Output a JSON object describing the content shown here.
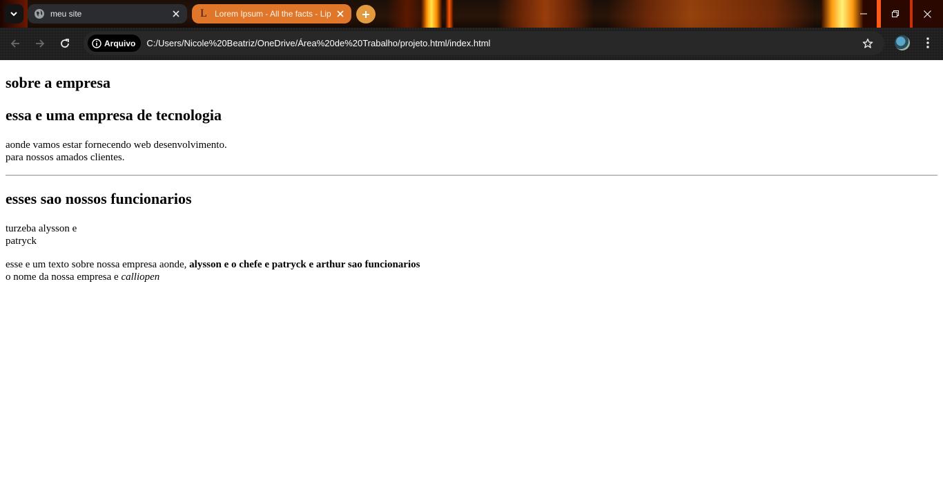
{
  "browser": {
    "tabs": [
      {
        "title": "meu site",
        "active": true
      },
      {
        "title": "Lorem Ipsum - All the facts - Lip",
        "active": false,
        "favicon_letter": "L"
      }
    ],
    "address_bar": {
      "chip_label": "Arquivo",
      "url": "C:/Users/Nicole%20Beatriz/OneDrive/Área%20de%20Trabalho/projeto.html/index.html"
    },
    "icons": {
      "tab_search": "chevron-down-icon",
      "new_tab": "plus-icon",
      "back": "back-arrow-icon",
      "forward": "forward-arrow-icon",
      "reload": "reload-icon",
      "info": "info-icon",
      "bookmark": "star-icon",
      "menu": "kebab-menu-icon"
    },
    "colors": {
      "active_tab": "#2a2c2f",
      "inactive_tab": "#e0762a",
      "new_tab_button": "#e39b3f",
      "toolbar": "#1f1f1f"
    }
  },
  "page": {
    "heading1": "sobre a empresa",
    "heading2": "essa e uma empresa de tecnologia",
    "intro_line1": "aonde vamos estar fornecendo web desenvolvimento.",
    "intro_line2": "para nossos amados clientes.",
    "heading3": "esses sao nossos funcionarios",
    "employees_line1": "turzeba alysson e",
    "employees_line2": "patryck",
    "text_prefix": "esse e um texto sobre nossa empresa aonde,",
    "text_bold": "alysson e o chefe e patryck e arthur sao funcionarios",
    "name_prefix": "o nome da nossa empresa e",
    "name_italic": "calliopen"
  }
}
